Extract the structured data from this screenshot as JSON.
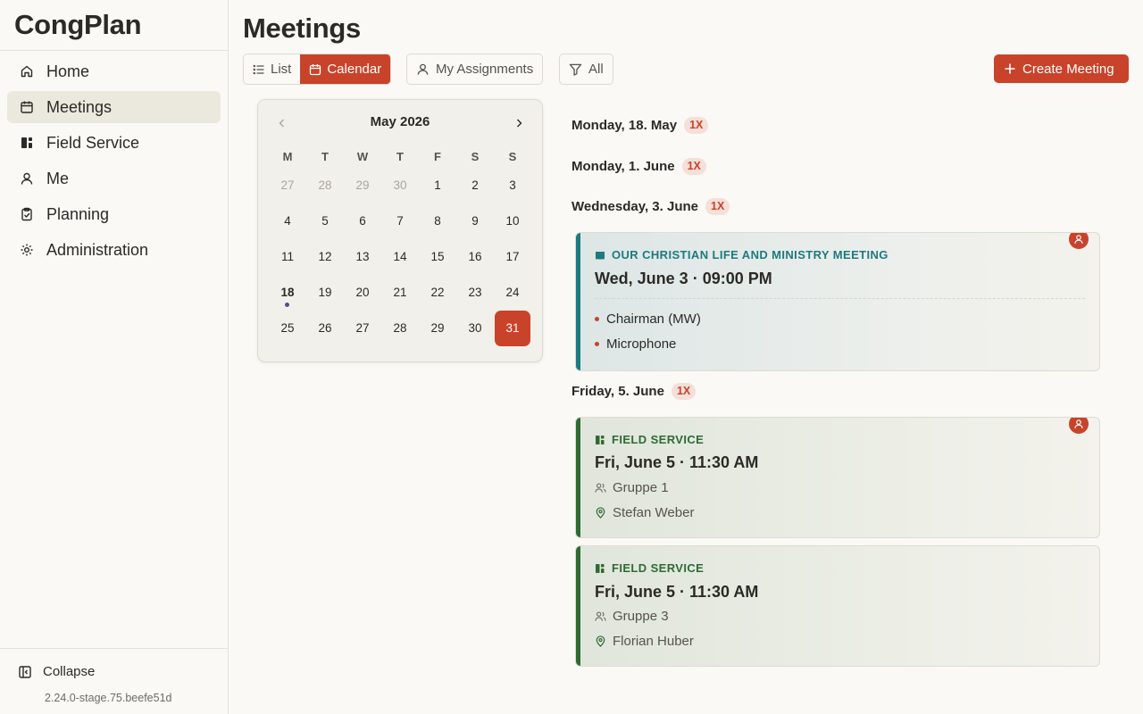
{
  "app": {
    "name": "CongPlan",
    "version": "2.24.0-stage.75.beefe51d"
  },
  "sidebar": {
    "items": [
      {
        "label": "Home",
        "icon": "home-icon"
      },
      {
        "label": "Meetings",
        "icon": "calendar-icon",
        "active": true
      },
      {
        "label": "Field Service",
        "icon": "field-service-icon"
      },
      {
        "label": "Me",
        "icon": "user-icon"
      },
      {
        "label": "Planning",
        "icon": "clipboard-check-icon"
      },
      {
        "label": "Administration",
        "icon": "gear-icon"
      }
    ],
    "collapse_label": "Collapse"
  },
  "page": {
    "title": "Meetings"
  },
  "toolbar": {
    "view_list": "List",
    "view_calendar": "Calendar",
    "my_assignments": "My Assignments",
    "filter": "All",
    "create": "Create Meeting"
  },
  "calendar": {
    "month_label": "May 2026",
    "weekdays": [
      "M",
      "T",
      "W",
      "T",
      "F",
      "S",
      "S"
    ],
    "days": [
      {
        "d": "27",
        "out": true
      },
      {
        "d": "28",
        "out": true
      },
      {
        "d": "29",
        "out": true
      },
      {
        "d": "30",
        "out": true
      },
      {
        "d": "1"
      },
      {
        "d": "2"
      },
      {
        "d": "3"
      },
      {
        "d": "4"
      },
      {
        "d": "5"
      },
      {
        "d": "6"
      },
      {
        "d": "7"
      },
      {
        "d": "8"
      },
      {
        "d": "9"
      },
      {
        "d": "10"
      },
      {
        "d": "11"
      },
      {
        "d": "12"
      },
      {
        "d": "13"
      },
      {
        "d": "14"
      },
      {
        "d": "15"
      },
      {
        "d": "16"
      },
      {
        "d": "17"
      },
      {
        "d": "18",
        "today": true
      },
      {
        "d": "19"
      },
      {
        "d": "20"
      },
      {
        "d": "21"
      },
      {
        "d": "22"
      },
      {
        "d": "23"
      },
      {
        "d": "24"
      },
      {
        "d": "25"
      },
      {
        "d": "26"
      },
      {
        "d": "27"
      },
      {
        "d": "28"
      },
      {
        "d": "29"
      },
      {
        "d": "30"
      },
      {
        "d": "31",
        "selected": true
      }
    ]
  },
  "schedule": {
    "days": [
      {
        "label": "Monday, 18. May",
        "badge": "1X"
      },
      {
        "label": "Monday, 1. June",
        "badge": "1X"
      },
      {
        "label": "Wednesday, 3. June",
        "badge": "1X"
      },
      {
        "label": "Friday, 5. June",
        "badge": "1X"
      }
    ],
    "cards": [
      {
        "kind": "OUR CHRISTIAN LIFE AND MINISTRY MEETING",
        "time": "Wed, June 3 · 09:00 PM",
        "assignments": [
          "Chairman (MW)",
          "Microphone"
        ]
      },
      {
        "kind": "FIELD SERVICE",
        "time": "Fri, June 5 · 11:30 AM",
        "group": "Gruppe 1",
        "location": "Stefan Weber"
      },
      {
        "kind": "FIELD SERVICE",
        "time": "Fri, June 5 · 11:30 AM",
        "group": "Gruppe 3",
        "location": "Florian Huber"
      }
    ]
  },
  "colors": {
    "accent": "#c8432a",
    "ministry": "#1d7a7f",
    "field_service": "#2f6a33",
    "background": "#faf9f5"
  }
}
